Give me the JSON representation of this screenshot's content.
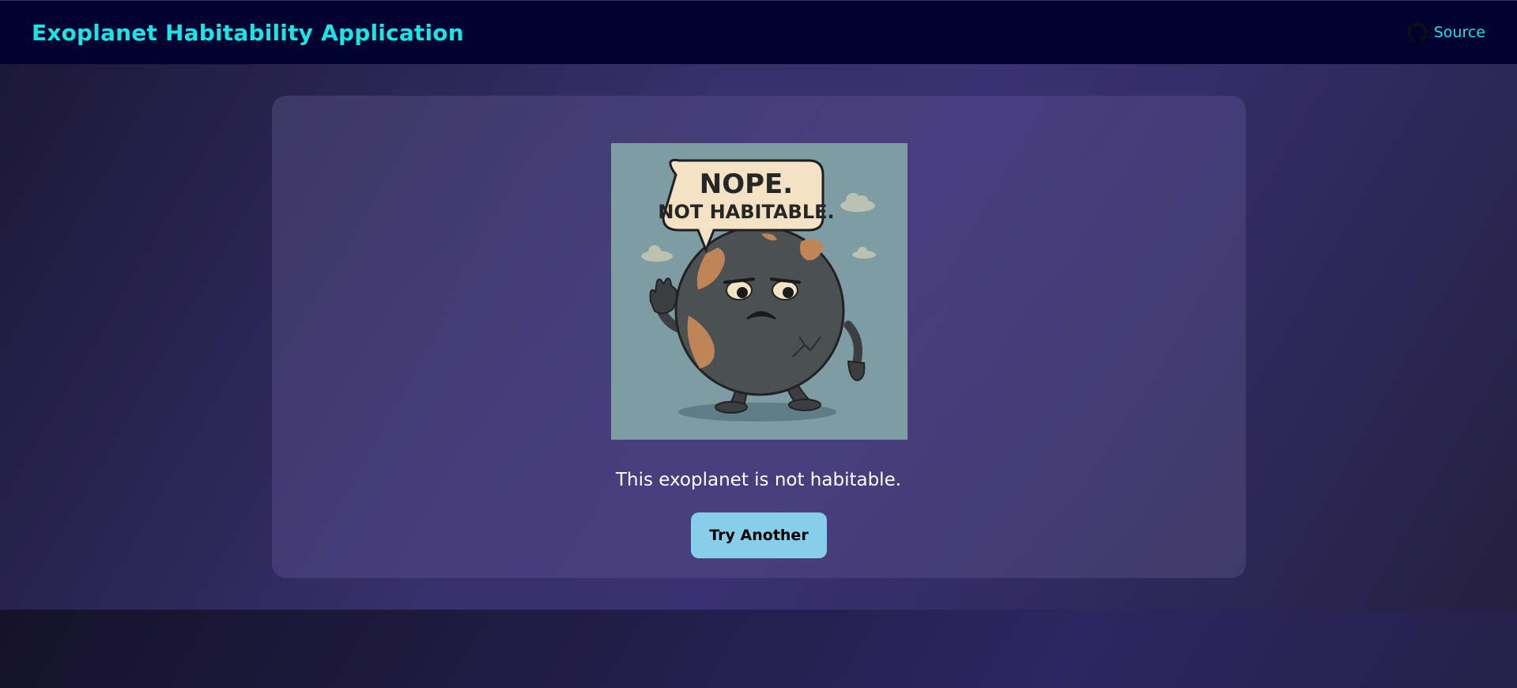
{
  "navbar": {
    "title": "Exoplanet Habitability Application",
    "source_label": "Source",
    "source_icon": "github-icon"
  },
  "result": {
    "image_caption_line1": "NOPE.",
    "image_caption_line2": "NOT HABITABLE.",
    "message": "This exoplanet is not habitable.",
    "try_another_label": "Try Another"
  },
  "colors": {
    "brand": "#16e6e6",
    "navbar_bg": "#00012e",
    "button_bg": "#87ceeb"
  }
}
